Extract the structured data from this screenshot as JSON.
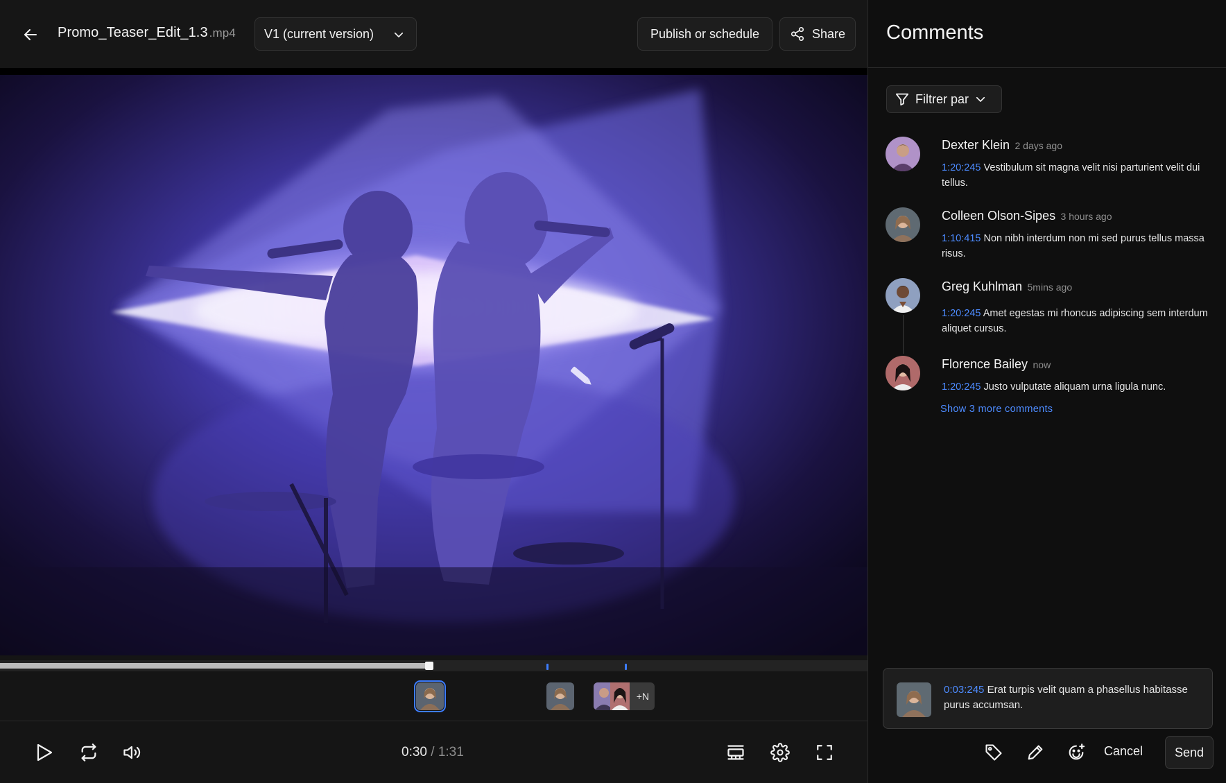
{
  "header": {
    "filename": "Promo_Teaser_Edit_1.3",
    "extension": ".mp4",
    "version_label": "V1 (current version)",
    "publish_label": "Publish or schedule",
    "share_label": "Share"
  },
  "player": {
    "current_time": "0:30",
    "separator": " / ",
    "duration": "1:31",
    "progress_fraction": 0.495,
    "comment_marker_fractions": [
      0.63,
      0.72
    ],
    "more_avatars_label": "+N"
  },
  "panel": {
    "title": "Comments",
    "filter_label": "Filtrer par",
    "comments": [
      {
        "name": "Dexter Klein",
        "time": "2 days ago",
        "timecode": "1:20:245",
        "text": "Vestibulum sit magna velit nisi parturient velit dui tellus."
      },
      {
        "name": "Colleen Olson-Sipes",
        "time": "3 hours ago",
        "timecode": "1:10:415",
        "text": "Non nibh interdum non mi sed purus tellus massa risus."
      },
      {
        "name": "Greg Kuhlman",
        "time": "5mins ago",
        "timecode": "1:20:245",
        "text": "Amet egestas mi rhoncus adipiscing sem interdum aliquet cursus."
      },
      {
        "name": "Florence Bailey",
        "time": "now",
        "timecode": "1:20:245",
        "text": "Justo vulputate aliquam urna ligula nunc."
      }
    ],
    "show_more_label": "Show 3 more comments",
    "composer": {
      "timecode": "0:03:245",
      "text": "Erat turpis velit quam a phasellus habitasse purus accumsan."
    },
    "cancel_label": "Cancel",
    "send_label": "Send"
  },
  "colors": {
    "accent": "#3d7dff",
    "timecode": "#4d8bff",
    "background": "#141414",
    "panel_background": "#0f0f0f"
  },
  "icons": [
    "back-arrow-icon",
    "chevron-down-icon",
    "share-icon",
    "play-icon",
    "loop-icon",
    "volume-icon",
    "subtitles-icon",
    "settings-gear-icon",
    "fullscreen-icon",
    "filter-funnel-icon",
    "tag-icon",
    "pencil-icon",
    "emoji-add-icon"
  ]
}
